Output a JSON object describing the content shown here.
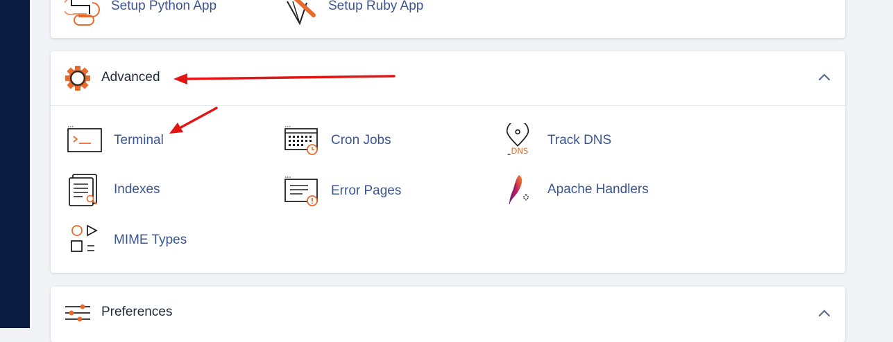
{
  "top_section": {
    "tools": [
      {
        "label": "Setup Python App",
        "icon": "python-icon"
      },
      {
        "label": "Setup Ruby App",
        "icon": "ruby-icon"
      }
    ]
  },
  "advanced": {
    "title": "Advanced",
    "icon": "gear-icon",
    "tools": [
      {
        "label": "Terminal",
        "icon": "terminal-icon"
      },
      {
        "label": "Cron Jobs",
        "icon": "cron-calendar-icon"
      },
      {
        "label": "Track DNS",
        "icon": "dns-pin-icon"
      },
      {
        "label": "Indexes",
        "icon": "index-document-icon"
      },
      {
        "label": "Error Pages",
        "icon": "error-page-icon"
      },
      {
        "label": "Apache Handlers",
        "icon": "apache-feather-icon"
      },
      {
        "label": "MIME Types",
        "icon": "mime-shapes-icon"
      }
    ]
  },
  "preferences": {
    "title": "Preferences",
    "icon": "sliders-icon"
  },
  "colors": {
    "sidebar": "#0a1a40",
    "link": "#3b5591",
    "accent": "#e86a2c",
    "annotation": "#e31414"
  }
}
